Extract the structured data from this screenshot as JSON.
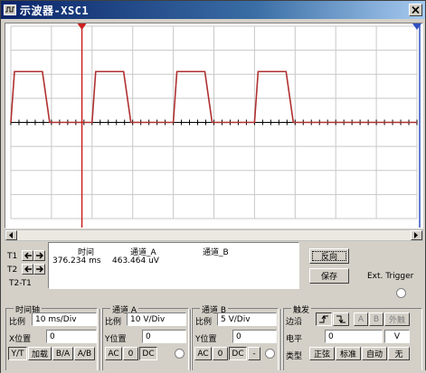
{
  "window": {
    "title": "示波器-XSC1"
  },
  "readout": {
    "col_time": "时间",
    "col_cha": "通道_A",
    "col_chb": "通道_B",
    "row1_time": "376.234 ms",
    "row1_cha": "463.464 uV",
    "row1_chb": ""
  },
  "cursors": {
    "t1": "T1",
    "t2": "T2",
    "t2t1": "T2-T1"
  },
  "buttons": {
    "reverse": "反向",
    "save": "保存",
    "ext_trigger": "Ext. Trigger"
  },
  "timebase": {
    "title": "时间轴",
    "scale_label": "比例",
    "scale_value": "10 ms/Div",
    "xpos_label": "X位置",
    "xpos_value": "0",
    "mode_yt": "Y/T",
    "mode_add": "加载",
    "mode_ba": "B/A",
    "mode_ab": "A/B"
  },
  "channel_a": {
    "title": "通道 A",
    "scale_label": "比例",
    "scale_value": "10 V/Div",
    "ypos_label": "Y位置",
    "ypos_value": "0",
    "ac": "AC",
    "zero": "0",
    "dc": "DC"
  },
  "channel_b": {
    "title": "通道 B",
    "scale_label": "比例",
    "scale_value": "5 V/Div",
    "ypos_label": "Y位置",
    "ypos_value": "0",
    "ac": "AC",
    "zero": "0",
    "dc": "DC",
    "minus": "-"
  },
  "trigger": {
    "title": "触发",
    "edge_label": "边沿",
    "level_label": "电平",
    "level_value": "0",
    "level_unit": "V",
    "edge_a": "A",
    "edge_b": "B",
    "edge_ext": "外触",
    "type_label": "类型",
    "normal": "正弦",
    "standard": "标准",
    "auto": "自动",
    "none": "无"
  },
  "scope": {
    "background": "#ffffff",
    "grid_color": "#c8c8c8",
    "trace_color": "#b03030",
    "cursor1_color": "#cc2020",
    "cursor2_color": "#3050c0",
    "pulses": [
      {
        "start": 0.0,
        "end": 1.0
      },
      {
        "start": 2.0,
        "end": 3.0
      },
      {
        "start": 4.0,
        "end": 5.0
      },
      {
        "start": 6.0,
        "end": 7.0
      }
    ]
  }
}
